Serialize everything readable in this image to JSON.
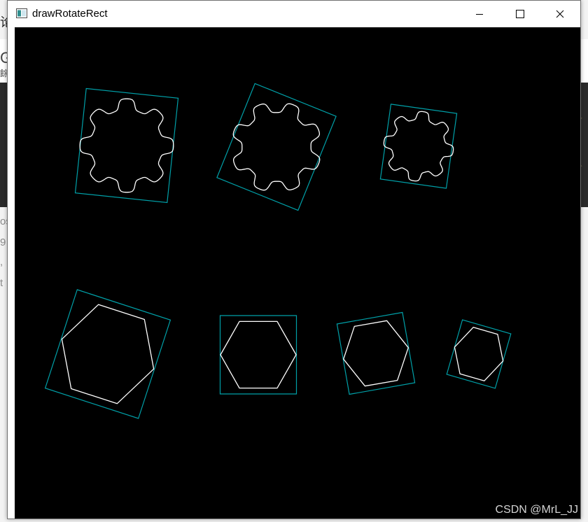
{
  "window": {
    "title": "drawRotateRect",
    "controls": [
      "minimize-icon",
      "maximize-icon",
      "close-icon"
    ]
  },
  "canvas": {
    "background": "#000000",
    "rect_color": "#00a0a8",
    "contour_color": "#ffffff",
    "shapes": [
      "gear-contour-1",
      "gear-contour-2",
      "gear-contour-3",
      "hexagon-contour-1",
      "hexagon-contour-2",
      "hexagon-contour-3",
      "hexagon-contour-4"
    ]
  },
  "watermark": "CSDN @MrL_JJ",
  "background_fragments": [
    "论",
    "G",
    "餘",
    "os",
    "9",
    ",",
    "t"
  ]
}
